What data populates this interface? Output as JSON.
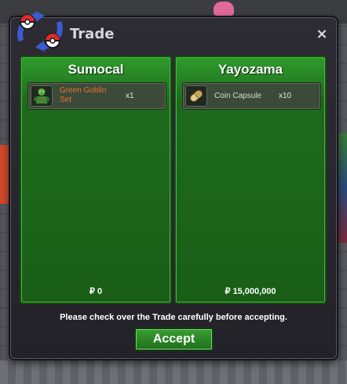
{
  "window": {
    "title": "Trade",
    "close_glyph": "×",
    "notice": "Please check over the Trade carefully before accepting.",
    "accept_label": "Accept"
  },
  "left_panel": {
    "player": "Sumocal",
    "items": [
      {
        "name": "Green Goblin Set",
        "quantity": "x1",
        "icon": "green-goblin-set-icon",
        "rarity_color": "#e3762a"
      }
    ],
    "money": "₽ 0"
  },
  "right_panel": {
    "player": "Yayozama",
    "items": [
      {
        "name": "Coin Capsule",
        "quantity": "x10",
        "icon": "coin-capsule-icon"
      }
    ],
    "money": "₽ 15,000,000"
  },
  "colors": {
    "panel_green": "#1e6b1c",
    "window_bg": "#2d2b33",
    "rare_item": "#e3762a"
  }
}
